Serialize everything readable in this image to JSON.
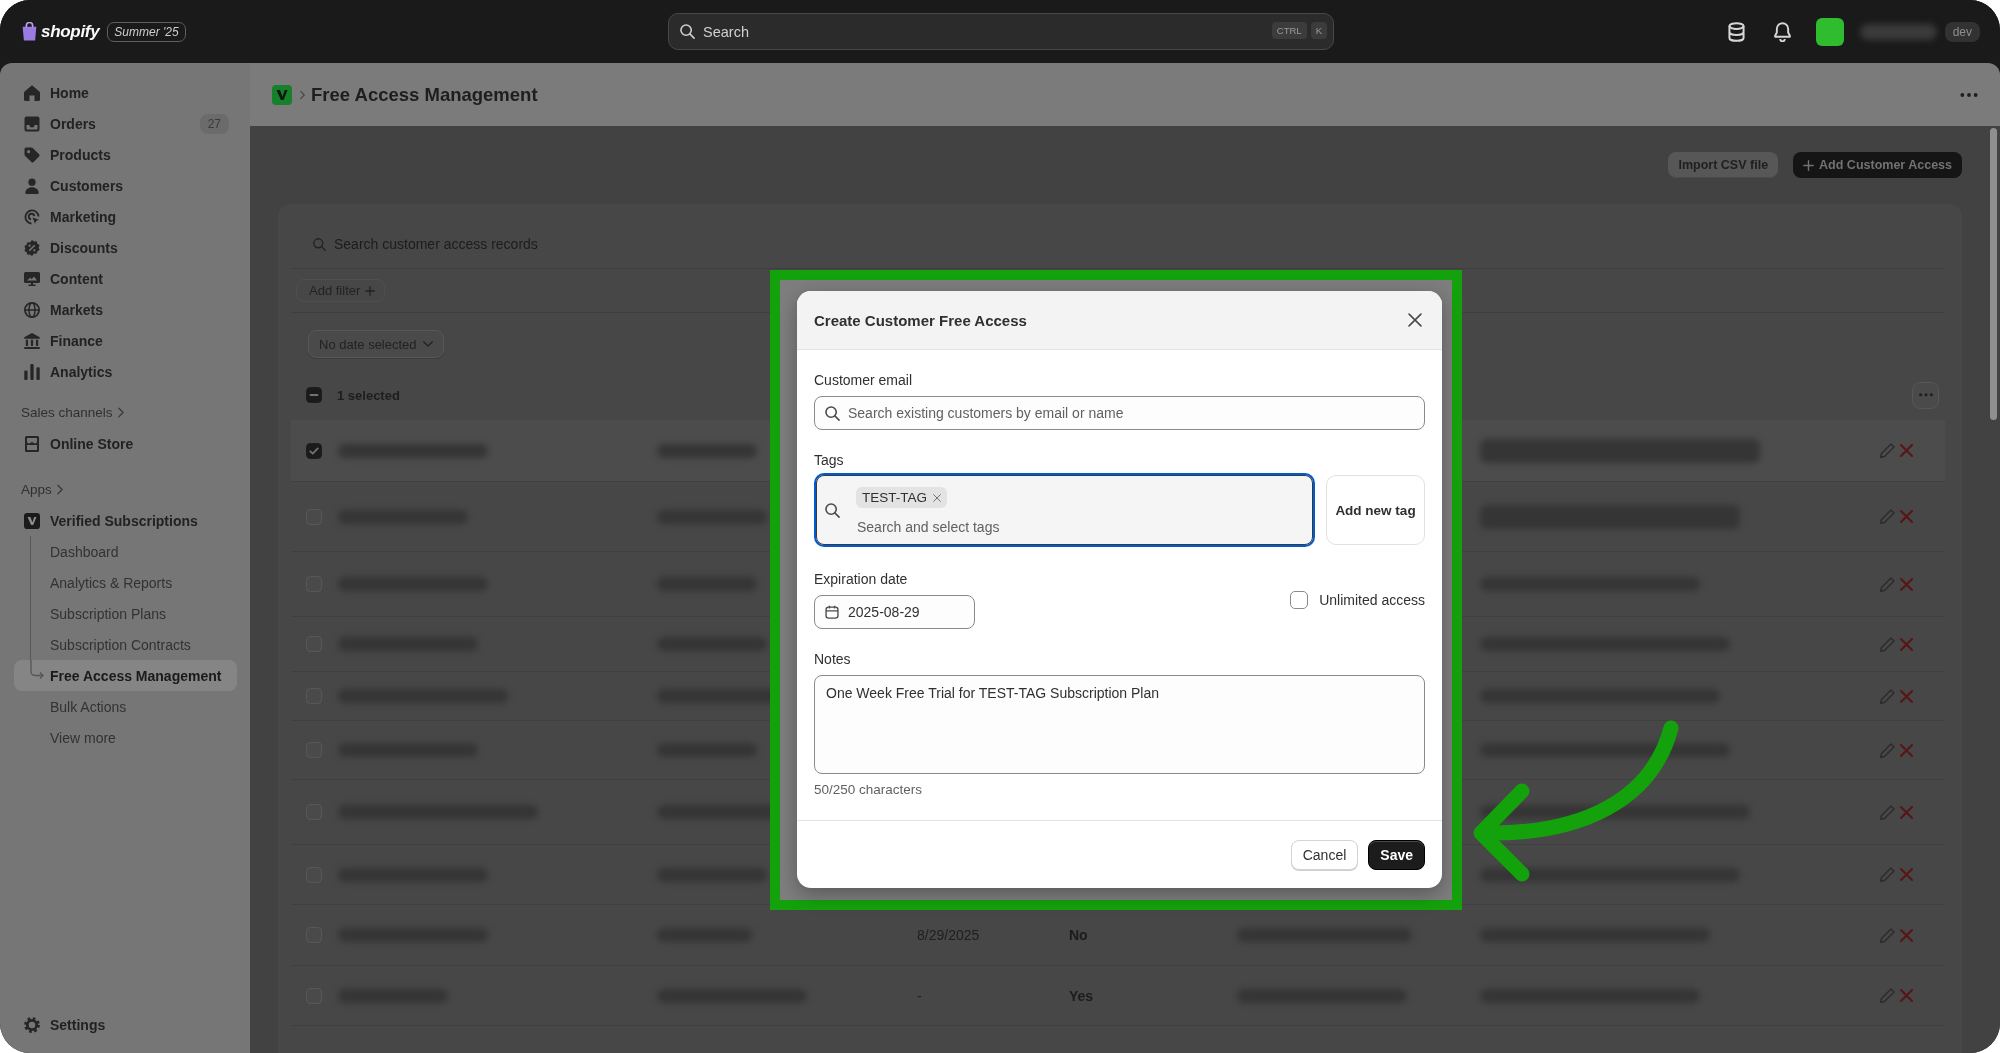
{
  "top_bar": {
    "logo": "shopify",
    "edition": "Summer '25",
    "search": {
      "placeholder": "Search",
      "shortcut_keys": [
        "CTRL",
        "K"
      ]
    },
    "environment": "dev"
  },
  "sidebar": {
    "items": [
      {
        "label": "Home",
        "selected": false
      },
      {
        "label": "Orders",
        "badge": "27",
        "selected": false
      },
      {
        "label": "Products",
        "selected": false
      },
      {
        "label": "Customers",
        "selected": false
      },
      {
        "label": "Marketing",
        "selected": false
      },
      {
        "label": "Discounts",
        "selected": false
      },
      {
        "label": "Content",
        "selected": false
      },
      {
        "label": "Markets",
        "selected": false
      },
      {
        "label": "Finance",
        "selected": false
      },
      {
        "label": "Analytics",
        "selected": false
      }
    ],
    "sales_channels": {
      "heading": "Sales channels",
      "items": [
        {
          "label": "Online Store",
          "selected": false
        }
      ]
    },
    "apps": {
      "heading": "Apps",
      "items": [
        {
          "label": "Verified Subscriptions",
          "selected": false,
          "children": [
            {
              "label": "Dashboard",
              "selected": false
            },
            {
              "label": "Analytics & Reports",
              "selected": false
            },
            {
              "label": "Subscription Plans",
              "selected": false
            },
            {
              "label": "Subscription Contracts",
              "selected": false
            },
            {
              "label": "Free Access Management",
              "selected": true
            },
            {
              "label": "Bulk Actions",
              "selected": false
            },
            {
              "label": "View more",
              "selected": false
            }
          ]
        }
      ]
    },
    "footer_items": [
      {
        "label": "Settings",
        "selected": false
      }
    ]
  },
  "page": {
    "title": "Free Access Management",
    "actions": [
      {
        "label": "Import CSV file",
        "kind": "secondary"
      },
      {
        "label": "Add Customer Access",
        "kind": "primary"
      }
    ],
    "search": {
      "placeholder": "Search customer access records"
    },
    "add_filter": "Add filter",
    "date_filter": "No date selected",
    "table": {
      "selection": {
        "label": "1 selected",
        "indeterminate": true
      },
      "rows": [
        {
          "selected": true,
          "cells": [
            {
              "kind": "blurred"
            },
            {
              "kind": "blurred"
            },
            null,
            null,
            null,
            {
              "kind": "blurred"
            }
          ]
        },
        {
          "selected": false,
          "cells": [
            {
              "kind": "blurred"
            },
            {
              "kind": "blurred"
            },
            null,
            null,
            null,
            {
              "kind": "blurred"
            }
          ]
        },
        {
          "selected": false,
          "cells": [
            {
              "kind": "blurred"
            },
            {
              "kind": "blurred"
            },
            null,
            null,
            null,
            {
              "kind": "blurred"
            }
          ]
        },
        {
          "selected": false,
          "cells": [
            {
              "kind": "blurred"
            },
            {
              "kind": "blurred"
            },
            null,
            null,
            null,
            {
              "kind": "blurred"
            }
          ]
        },
        {
          "selected": false,
          "cells": [
            {
              "kind": "blurred"
            },
            {
              "kind": "blurred"
            },
            null,
            null,
            null,
            {
              "kind": "blurred"
            }
          ]
        },
        {
          "selected": false,
          "cells": [
            {
              "kind": "blurred"
            },
            {
              "kind": "blurred"
            },
            null,
            null,
            null,
            {
              "kind": "blurred"
            }
          ]
        },
        {
          "selected": false,
          "cells": [
            {
              "kind": "blurred"
            },
            {
              "kind": "blurred"
            },
            null,
            null,
            null,
            {
              "kind": "blurred"
            }
          ]
        },
        {
          "selected": false,
          "cells": [
            {
              "kind": "blurred"
            },
            {
              "kind": "blurred"
            },
            null,
            null,
            null,
            {
              "kind": "blurred"
            }
          ]
        },
        {
          "selected": false,
          "cells": [
            {
              "kind": "blurred"
            },
            {
              "kind": "blurred"
            },
            {
              "kind": "text",
              "text": "8/29/2025"
            },
            {
              "kind": "text",
              "text": "No"
            },
            {
              "kind": "blurred"
            },
            {
              "kind": "blurred"
            }
          ]
        },
        {
          "selected": false,
          "cells": [
            {
              "kind": "blurred"
            },
            {
              "kind": "blurred"
            },
            {
              "kind": "text",
              "text": "-"
            },
            {
              "kind": "text",
              "text": "Yes"
            },
            {
              "kind": "blurred"
            },
            {
              "kind": "blurred"
            }
          ]
        }
      ]
    }
  },
  "dialog": {
    "title": "Create Customer Free Access",
    "customer_email": {
      "label": "Customer email",
      "placeholder": "Search existing customers by email or name"
    },
    "tags": {
      "label": "Tags",
      "focused": true,
      "chips": [
        {
          "label": "TEST-TAG"
        }
      ],
      "placeholder": "Search and select tags",
      "add_button": "Add new tag"
    },
    "expiration_date": {
      "label": "Expiration date",
      "value": "2025-08-29"
    },
    "unlimited_access": {
      "label": "Unlimited access",
      "checked": false
    },
    "notes": {
      "label": "Notes",
      "value": "One Week Free Trial for TEST-TAG Subscription Plan",
      "counter": "50/250 characters"
    },
    "buttons": [
      {
        "label": "Cancel",
        "kind": "secondary"
      },
      {
        "label": "Save",
        "kind": "primary"
      }
    ]
  }
}
